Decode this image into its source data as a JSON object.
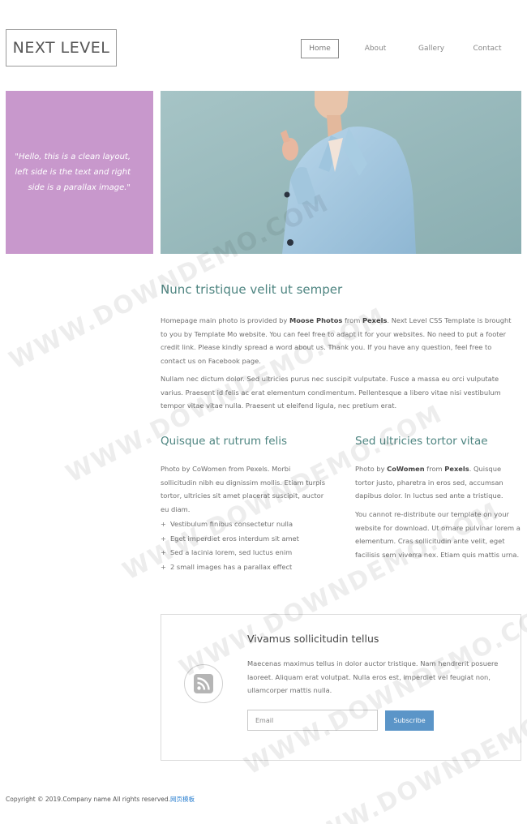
{
  "brand": {
    "logo_text": "NEXT LEVEL"
  },
  "nav": {
    "items": [
      {
        "label": "Home",
        "active": true
      },
      {
        "label": "About",
        "active": false
      },
      {
        "label": "Gallery",
        "active": false
      },
      {
        "label": "Contact",
        "active": false
      }
    ]
  },
  "intro": {
    "quote_line1": "\"Hello, this is a clean layout,",
    "quote_line2": "left side is the text and right",
    "quote_line3": "side is a parallax image.\""
  },
  "main": {
    "title": "Nunc tristique velit ut semper",
    "para1_a": "Homepage main photo is provided by ",
    "para1_b": "Moose Photos",
    "para1_c": " from ",
    "para1_d": "Pexels",
    "para1_e": ". Next Level CSS Template is brought to you by Templatе Mo website. You can feel free to adapt it for your websites. No need to put a footer credit link. Please kindly spread a word about us. Thank you. If you have any question, feel free to contact us on Facebook page.",
    "para2": "Nullam nec dictum dolor. Sed ultricies purus nec suscipit vulputate. Fusce a massa eu orci vulputate varius. Praesent id felis ac erat elementum condimentum. Pellentesque a libero vitae nisi vestibulum tempor vitae vitae nulla. Praesent ut eleifend ligula, nec pretium erat."
  },
  "left_col": {
    "title": "Quisque at rutrum felis",
    "text": "Photo by CoWomen from Pexels. Morbi sollicitudin nibh eu dignissim mollis. Etiam turpis tortor, ultricies sit amet placerat suscipit, auctor eu diam.",
    "bullets": [
      "Vestibulum finibus consectetur nulla",
      "Eget imperdiet eros interdum sit amet",
      "Sed a lacinia lorem, sed luctus enim",
      "2 small images has a parallax effect"
    ]
  },
  "right_col": {
    "title": "Sed ultricies tortor vitae",
    "text1_a": "Photo by ",
    "text1_b": "CoWomen",
    "text1_c": " from ",
    "text1_d": "Pexels",
    "text1_e": ". Quisque tortor justo, pharetra in eros sed, accumsan dapibus dolor. In luctus sed ante a tristique.",
    "text2": "You cannot re-distribute our template on your website for download. Ut ornare pulvinar lorem a elementum. Cras sollicitudin ante velit, eget facilisis sem viverra nex. Etiam quis mattis urna."
  },
  "subscribe": {
    "title": "Vivamus sollicitudin tellus",
    "text": "Maecenas maximus tellus in dolor auctor tristique. Nam hendrerit posuere laoreet. Aliquam erat volutpat. Nulla eros est, imperdiet vel feugiat non, ullamcorper mattis nulla.",
    "input_placeholder": "Email",
    "input_value": "",
    "button_label": "Subscribe",
    "icon": "rss-icon"
  },
  "footer": {
    "copyright": "Copyright © 2019.Company name All rights reserved.",
    "link_text": "网页模板"
  },
  "watermark": "WWW.DOWNDEMO.COM",
  "colors": {
    "accent_teal": "#4e8581",
    "quote_bg": "#c898cc",
    "button_blue": "#5b95c8",
    "footer_link": "#2a7fd0",
    "hero_bg": "#95b7ba"
  }
}
